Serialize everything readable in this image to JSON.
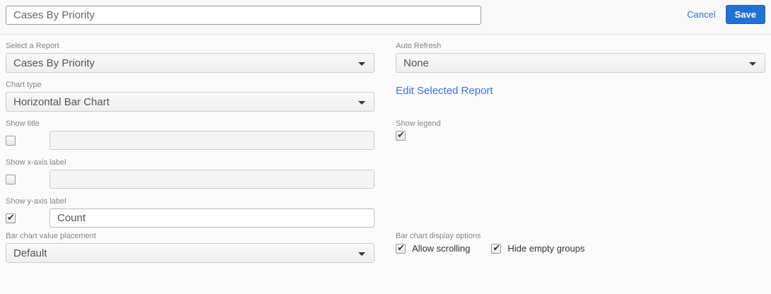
{
  "header": {
    "title_input": {
      "value": "Cases By Priority"
    },
    "cancel_label": "Cancel",
    "save_label": "Save"
  },
  "colors": {
    "accent_blue": "#2272d2",
    "link_blue": "#3b74d1",
    "label_gray": "#848484"
  },
  "form": {
    "left": {
      "select_report": {
        "label": "Select a Report",
        "value": "Cases By Priority"
      },
      "chart_type": {
        "label": "Chart type",
        "value": "Horizontal Bar Chart"
      },
      "show_title": {
        "label": "Show title",
        "checked": false,
        "value": ""
      },
      "show_x_axis": {
        "label": "Show x-axis label",
        "checked": false,
        "value": ""
      },
      "show_y_axis": {
        "label": "Show y-axis label",
        "checked": true,
        "value": "Count"
      },
      "value_placement": {
        "label": "Bar chart value placement",
        "value": "Default"
      }
    },
    "right": {
      "auto_refresh": {
        "label": "Auto Refresh",
        "value": "None"
      },
      "edit_report_link": "Edit Selected Report",
      "show_legend": {
        "label": "Show legend",
        "checked": true
      },
      "display_options": {
        "label": "Bar chart display options",
        "options": [
          {
            "label": "Allow scrolling",
            "checked": true
          },
          {
            "label": "Hide empty groups",
            "checked": true
          }
        ]
      }
    }
  }
}
